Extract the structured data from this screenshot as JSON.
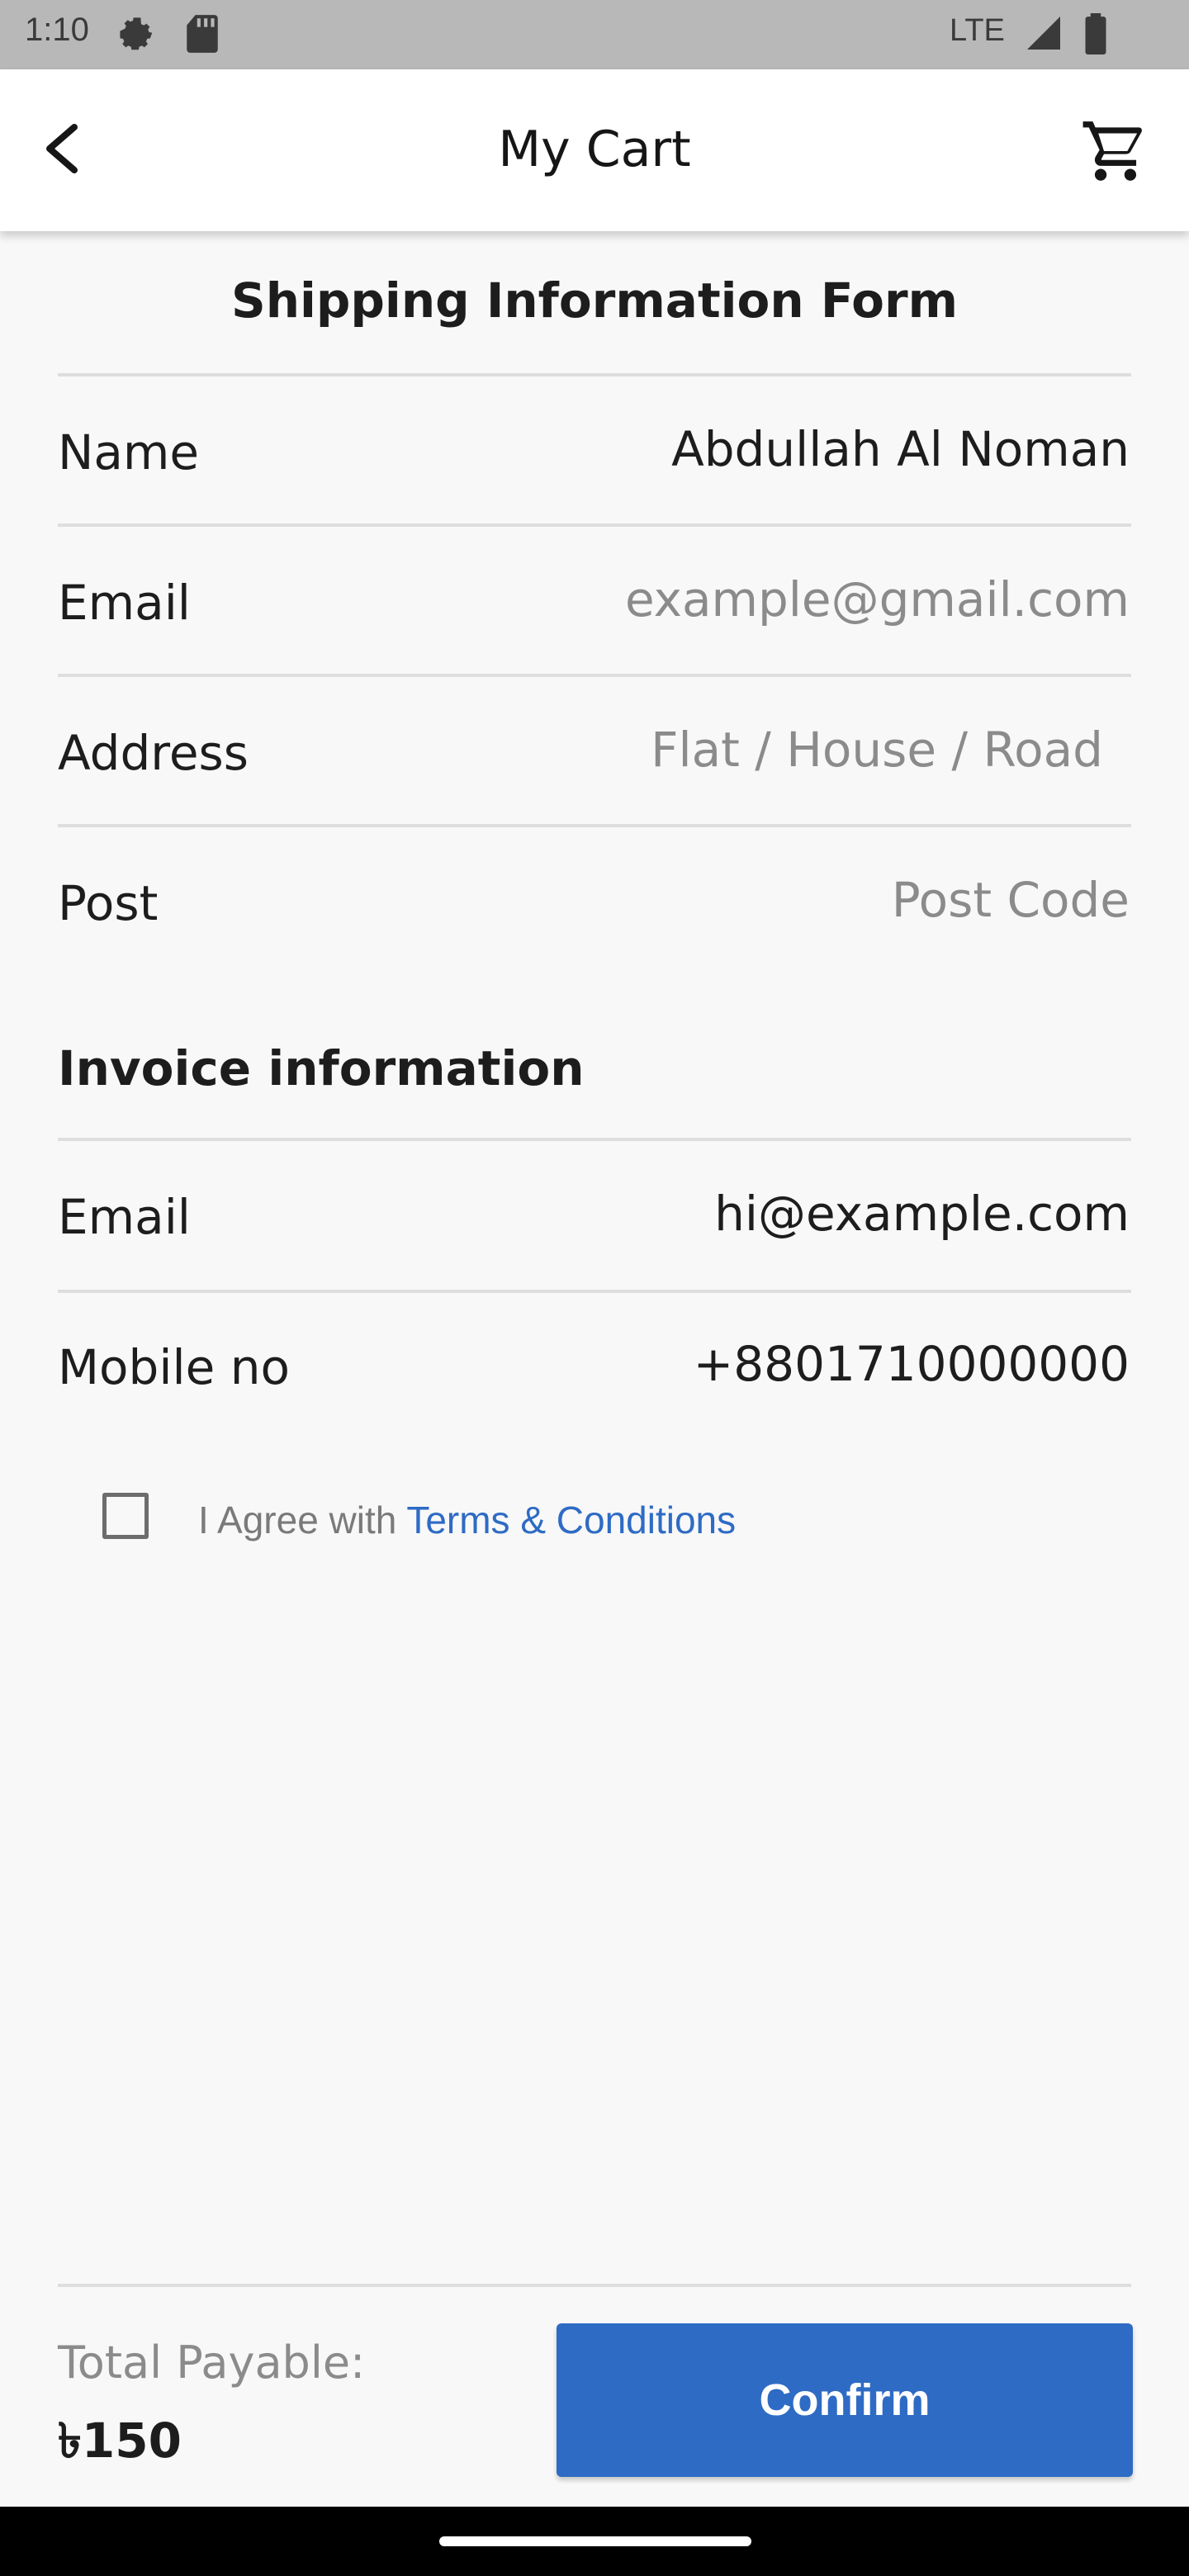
{
  "status_bar": {
    "time": "1:10",
    "network": "LTE",
    "icons": [
      "settings-gear-icon",
      "sd-card-icon",
      "signal-icon",
      "battery-icon"
    ]
  },
  "app_bar": {
    "title": "My Cart",
    "back_icon": "back-arrow-icon",
    "cart_icon": "shopping-cart-icon"
  },
  "shipping_form": {
    "title": "Shipping Information Form",
    "name": {
      "label": "Name",
      "value": "Abdullah Al Noman",
      "placeholder": ""
    },
    "email": {
      "label": "Email",
      "value": "",
      "placeholder": "example@gmail.com"
    },
    "address": {
      "label": "Address",
      "value": "",
      "placeholder": "Flat / House / Road"
    },
    "post": {
      "label": "Post",
      "value": "",
      "placeholder": "Post Code"
    }
  },
  "invoice": {
    "title": "Invoice information",
    "email": {
      "label": "Email",
      "value": "hi@example.com"
    },
    "mobile": {
      "label": "Mobile no",
      "value": "+8801710000000"
    }
  },
  "agreement": {
    "prefix": "I Agree with ",
    "link": "Terms & Conditions",
    "checked": false
  },
  "footer": {
    "total_label": "Total Payable:",
    "total_value": "৳150",
    "confirm_label": "Confirm"
  },
  "colors": {
    "accent": "#2e6bc4",
    "background": "#f8f8f8",
    "status_bar": "#b8b8b8"
  }
}
